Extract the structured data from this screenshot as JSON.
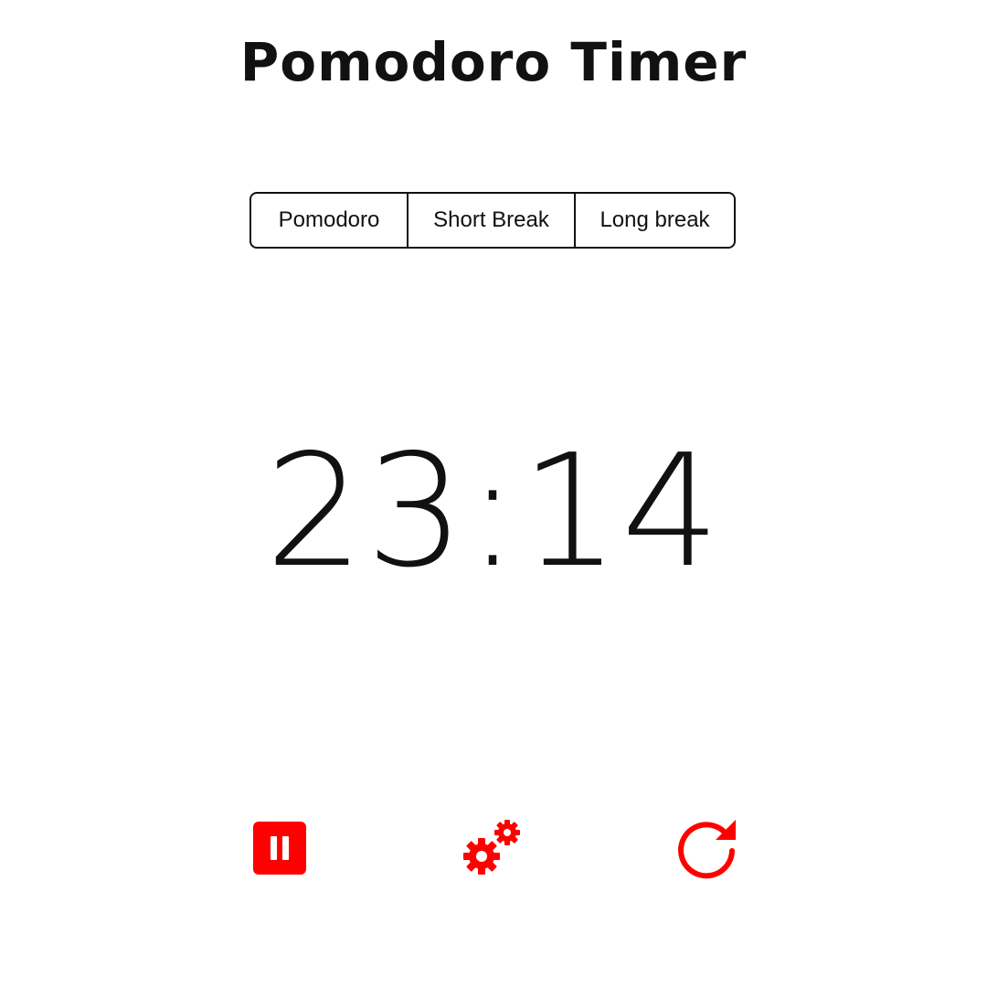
{
  "header": {
    "title": "Pomodoro Timer"
  },
  "modes": {
    "tabs": [
      {
        "label": "Pomodoro"
      },
      {
        "label": "Short Break"
      },
      {
        "label": "Long break"
      }
    ]
  },
  "timer": {
    "display": "23:14"
  },
  "controls": {
    "accent_color": "#ff0000",
    "pause_icon": "pause-icon",
    "settings_icon": "gears-icon",
    "reset_icon": "refresh-icon"
  }
}
